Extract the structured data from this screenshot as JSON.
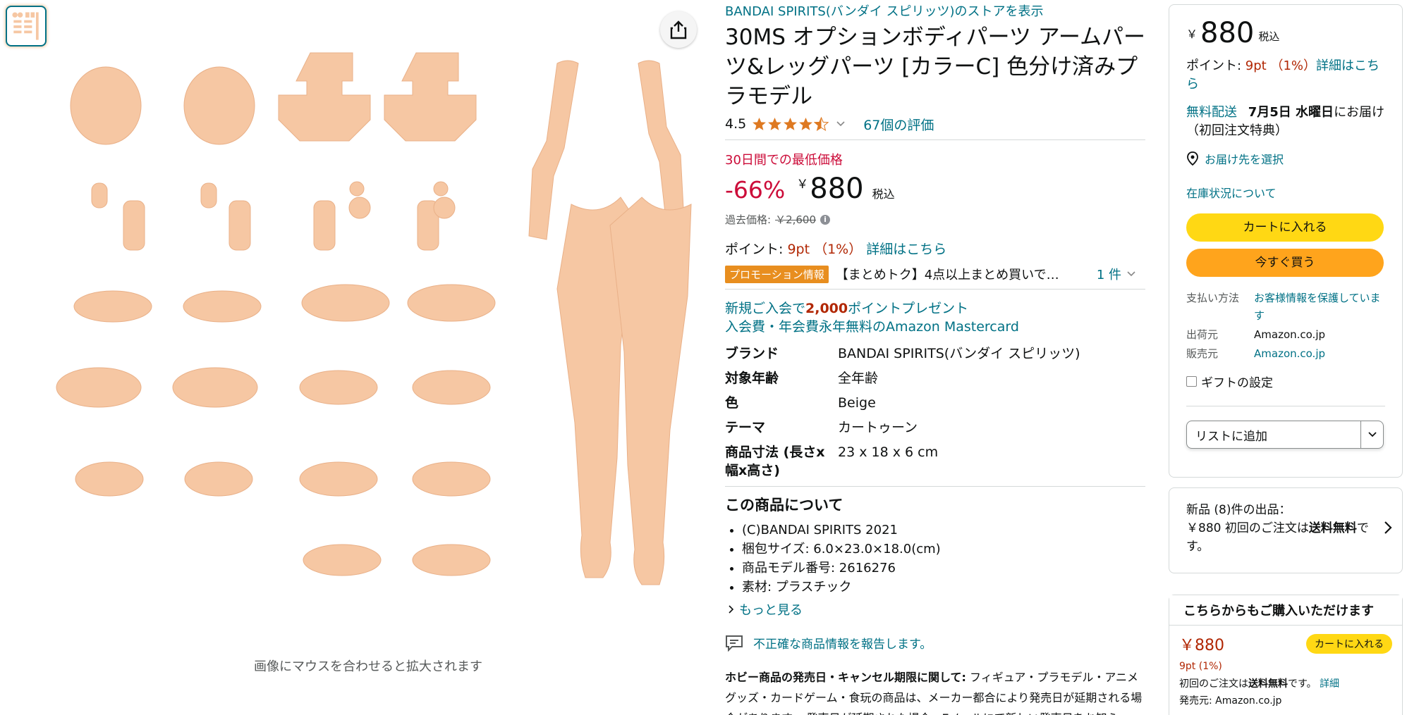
{
  "store_link": "BANDAI SPIRITS(バンダイ スピリッツ)のストアを表示",
  "title": "30MS オプションボディパーツ アームパーツ&レッグパーツ [カラーC] 色分け済みプラモデル",
  "rating": {
    "score": "4.5",
    "stars": 4.5,
    "count_text": "67個の評価"
  },
  "low_price_label": "30日間での最低価格",
  "price": {
    "discount": "-66%",
    "currency": "￥",
    "value": "880",
    "tax": "税込"
  },
  "past_price": {
    "label": "過去価格:",
    "value": "￥2,600"
  },
  "points": {
    "label": "ポイント:",
    "value": "9pt （1%）",
    "link": "詳細はこちら"
  },
  "promo": {
    "badge": "プロモーション情報",
    "text": "【まとめトク】4点以上まとめ買いで…",
    "count": "1 件"
  },
  "signup": {
    "line1_prefix": "新規ご入会で",
    "line1_amount": "2,000",
    "line1_suffix": "ポイントプレゼント",
    "line2": "入会費・年会費永年無料のAmazon Mastercard"
  },
  "specs": [
    {
      "key": "ブランド",
      "value": "BANDAI SPIRITS(バンダイ スピリッツ)"
    },
    {
      "key": "対象年齢",
      "value": "全年齢"
    },
    {
      "key": "色",
      "value": "Beige"
    },
    {
      "key": "テーマ",
      "value": "カートゥーン"
    },
    {
      "key": "商品寸法 (長さx幅x高さ)",
      "value": "23 x 18 x 6 cm"
    }
  ],
  "about": {
    "title": "この商品について",
    "bullets": [
      "(C)BANDAI SPIRITS 2021",
      "梱包サイズ: 6.0×23.0×18.0(cm)",
      "商品モデル番号: 2616276",
      "素材: プラスチック"
    ],
    "more": "もっと見る"
  },
  "report": "不正確な商品情報を報告します。",
  "notice": {
    "bold": "ホビー商品の発売日・キャンセル期限に関して:",
    "text": " フィギュア・プラモデル・アニメグッズ・カードゲーム・食玩の商品は、メーカー都合により発売日が延期される場合があります。 発売日が延期された場合、Eメールにて新しい発売日をお知ら"
  },
  "zoom_hint": "画像にマウスを合わせると拡大されます",
  "buybox": {
    "currency": "￥",
    "price": "880",
    "tax": "税込",
    "points_label": "ポイント: ",
    "points_value": "9pt （1%）",
    "points_link": "詳細はこちら",
    "delivery_free": "無料配送",
    "delivery_date": "7月5日 水曜日",
    "delivery_suffix": "にお届け（初回注文特典）",
    "location": "お届け先を選択",
    "stock": "在庫状況について",
    "cart_button": "カートに入れる",
    "buy_button": "今すぐ買う",
    "payment_key": "支払い方法",
    "payment_val": "お客様情報を保護しています",
    "shipper_key": "出荷元",
    "shipper_val": "Amazon.co.jp",
    "seller_key": "販売元",
    "seller_val": "Amazon.co.jp",
    "gift": "ギフトの設定",
    "list_button": "リストに追加"
  },
  "newbox": {
    "line1": "新品 (8)件の出品：",
    "price": "￥880",
    "text_pre": "初回のご注文は",
    "text_bold": "送料無料",
    "text_post": "です。"
  },
  "otherbox": {
    "header": "こちらからもご購入いただけます",
    "price": "￥880",
    "cart": "カートに入れる",
    "points": "9pt (1%)",
    "ship_pre": "初回のご注文は",
    "ship_bold": "送料無料",
    "ship_post": "です。",
    "ship_link": "詳細",
    "seller_label": "発売元:",
    "seller": "Amazon.co.jp"
  },
  "colors": {
    "link": "#007185",
    "price_red": "#b12704",
    "deal_red": "#cc0c39",
    "cart_yellow": "#ffd814",
    "buy_orange": "#ffa41c",
    "promo_orange": "#e88e1f",
    "part_skin": "#f6c7a3"
  }
}
